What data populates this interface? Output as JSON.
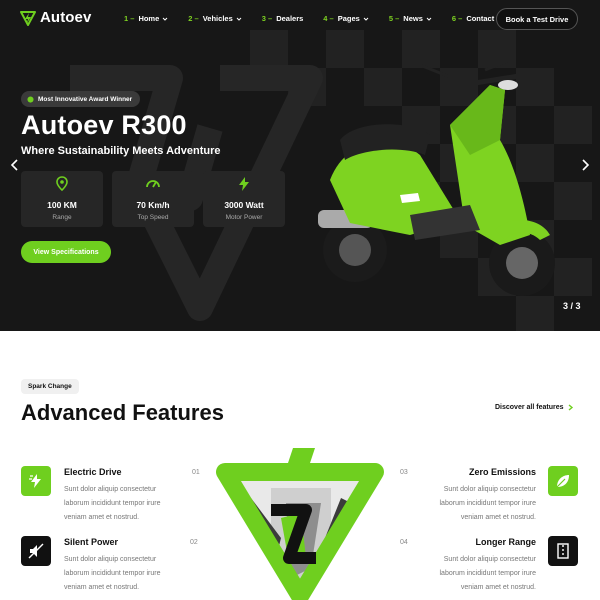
{
  "brand": {
    "name": "Autoev",
    "accent": "#6fcf1f"
  },
  "nav": {
    "items": [
      {
        "num": "1 –",
        "label": "Home",
        "dropdown": true
      },
      {
        "num": "2 –",
        "label": "Vehicles",
        "dropdown": true
      },
      {
        "num": "3 –",
        "label": "Dealers",
        "dropdown": false
      },
      {
        "num": "4 –",
        "label": "Pages",
        "dropdown": true
      },
      {
        "num": "5 –",
        "label": "News",
        "dropdown": true
      },
      {
        "num": "6 –",
        "label": "Contact",
        "dropdown": false
      }
    ],
    "cta": "Book a Test Drive"
  },
  "hero": {
    "badge": "Most Innovative Award Winner",
    "title": "Autoev R300",
    "subtitle": "Where Sustainability Meets Adventure",
    "stats": [
      {
        "icon": "map-pin-icon",
        "value": "100 KM",
        "label": "Range"
      },
      {
        "icon": "speedometer-icon",
        "value": "70 Km/h",
        "label": "Top Speed"
      },
      {
        "icon": "lightning-icon",
        "value": "3000 Watt",
        "label": "Motor Power"
      }
    ],
    "button": "View Specifications",
    "slide": "3 / 3"
  },
  "features": {
    "tag": "Spark Change",
    "title": "Advanced Features",
    "discover": "Discover all features",
    "items": [
      {
        "num": "01",
        "title": "Electric Drive",
        "desc1": "Sunt dolor aliquip consectetur",
        "desc2": "laborum incididunt tempor irure",
        "desc3": "veniam amet et nostrud.",
        "icon": "electric-bolt-icon"
      },
      {
        "num": "02",
        "title": "Silent Power",
        "desc1": "Sunt dolor aliquip consectetur",
        "desc2": "laborum incididunt tempor irure",
        "desc3": "veniam amet et nostrud.",
        "icon": "mute-speaker-icon"
      },
      {
        "num": "03",
        "title": "Zero Emissions",
        "desc1": "Sunt dolor aliquip consectetur",
        "desc2": "laborum incididunt tempor irure",
        "desc3": "veniam amet et nostrud.",
        "icon": "leaf-icon"
      },
      {
        "num": "04",
        "title": "Longer Range",
        "desc1": "Sunt dolor aliquip consectetur",
        "desc2": "laborum incididunt tempor irure",
        "desc3": "veniam amet et nostrud.",
        "icon": "road-icon"
      }
    ]
  }
}
